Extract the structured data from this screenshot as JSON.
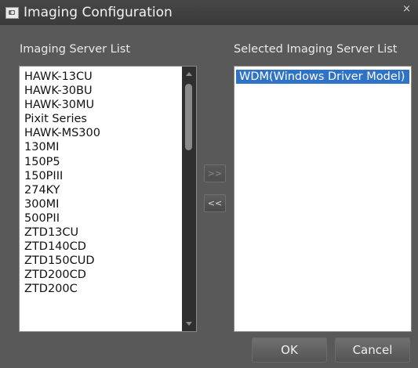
{
  "window": {
    "title": "Imaging Configuration",
    "close_glyph": "×"
  },
  "left_panel": {
    "label": "Imaging Server List",
    "items": [
      "HAWK-13CU",
      "HAWK-30BU",
      "HAWK-30MU",
      "Pixit Series",
      "HAWK-MS300",
      "130MI",
      "150P5",
      "150PIII",
      "274KY",
      "300MI",
      "500PII",
      "ZTD13CU",
      "ZTD140CD",
      "ZTD150CUD",
      "ZTD200CD",
      "ZTD200C"
    ]
  },
  "right_panel": {
    "label": "Selected Imaging Server List",
    "items": [
      "WDM(Windows Driver Model)"
    ]
  },
  "buttons": {
    "add_label": ">>",
    "remove_label": "<<",
    "ok_label": "OK",
    "cancel_label": "Cancel"
  },
  "colors": {
    "selection": "#2e73c8",
    "dialog_bg": "#595959"
  }
}
